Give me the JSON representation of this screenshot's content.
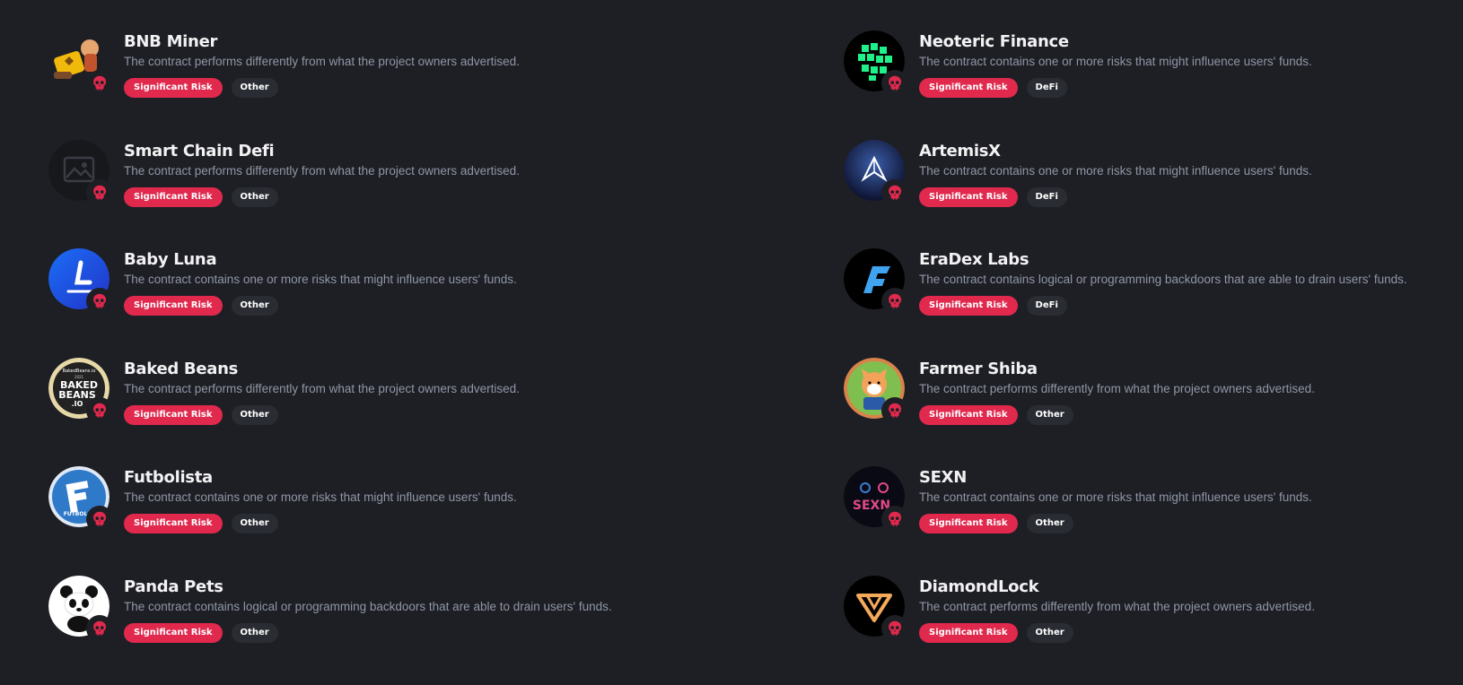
{
  "projects": [
    {
      "name": "BNB Miner",
      "description": "The contract performs differently from what the project owners advertised.",
      "risk": "Significant Risk",
      "category": "Other",
      "logo_icon": "bnb-miner-logo-icon"
    },
    {
      "name": "Neoteric Finance",
      "description": "The contract contains one or more risks that might influence users' funds.",
      "risk": "Significant Risk",
      "category": "DeFi",
      "logo_icon": "neoteric-finance-logo-icon"
    },
    {
      "name": "Smart Chain Defi",
      "description": "The contract performs differently from what the project owners advertised.",
      "risk": "Significant Risk",
      "category": "Other",
      "logo_icon": "image-placeholder-icon"
    },
    {
      "name": "ArtemisX",
      "description": "The contract contains one or more risks that might influence users' funds.",
      "risk": "Significant Risk",
      "category": "DeFi",
      "logo_icon": "artemisx-logo-icon"
    },
    {
      "name": "Baby Luna",
      "description": "The contract contains one or more risks that might influence users' funds.",
      "risk": "Significant Risk",
      "category": "Other",
      "logo_icon": "baby-luna-logo-icon"
    },
    {
      "name": "EraDex Labs",
      "description": "The contract contains logical or programming backdoors that are able to drain users' funds.",
      "risk": "Significant Risk",
      "category": "DeFi",
      "logo_icon": "eradex-logo-icon"
    },
    {
      "name": "Baked Beans",
      "description": "The contract performs differently from what the project owners advertised.",
      "risk": "Significant Risk",
      "category": "Other",
      "logo_icon": "baked-beans-logo-icon",
      "logo_text": [
        "BakedBeans.io",
        "2021",
        "BAKED",
        "BEANS",
        ".IO"
      ]
    },
    {
      "name": "Farmer Shiba",
      "description": "The contract performs differently from what the project owners advertised.",
      "risk": "Significant Risk",
      "category": "Other",
      "logo_icon": "farmer-shiba-logo-icon"
    },
    {
      "name": "Futbolista",
      "description": "The contract contains one or more risks that might influence users' funds.",
      "risk": "Significant Risk",
      "category": "Other",
      "logo_icon": "futbolista-logo-icon",
      "logo_text": [
        "FUTBOL"
      ]
    },
    {
      "name": "SEXN",
      "description": "The contract contains one or more risks that might influence users' funds.",
      "risk": "Significant Risk",
      "category": "Other",
      "logo_icon": "sexn-logo-icon",
      "logo_text": [
        "SEXN"
      ]
    },
    {
      "name": "Panda Pets",
      "description": "The contract contains logical or programming backdoors that are able to drain users' funds.",
      "risk": "Significant Risk",
      "category": "Other",
      "logo_icon": "panda-pets-logo-icon"
    },
    {
      "name": "DiamondLock",
      "description": "The contract performs differently from what the project owners advertised.",
      "risk": "Significant Risk",
      "category": "Other",
      "logo_icon": "diamondlock-logo-icon"
    }
  ],
  "colors": {
    "background": "#1e1f24",
    "risk_tag": "#e0294d",
    "category_tag": "#2a2c33",
    "description": "#8f96a6"
  },
  "badge_icon": "skull-icon"
}
